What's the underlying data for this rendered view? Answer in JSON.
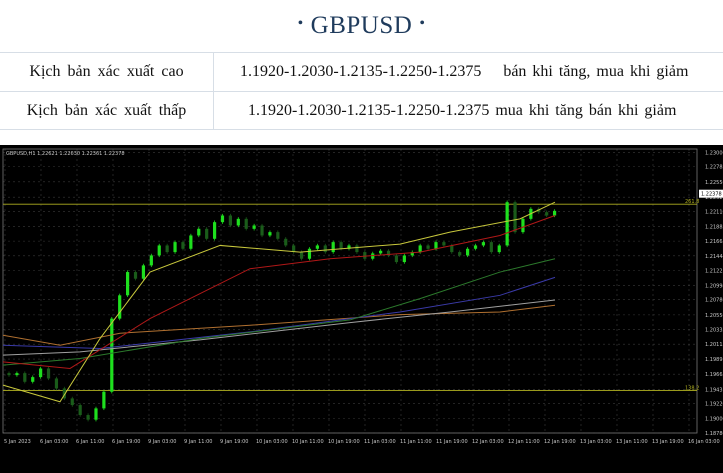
{
  "header": {
    "title": "GBPUSD",
    "dot": "•"
  },
  "scenarios": [
    {
      "label": "Kịch bản xác xuất cao",
      "levels": "1.1920-1.2030-1.2135-1.2250-1.2375",
      "action": "bán khi tăng, mua khi giảm"
    },
    {
      "label": "Kịch bản xác xuất thấp",
      "levels": "1.1920-1.2030-1.2135-1.2250-1.2375",
      "action": "mua khi tăng bán khi giảm"
    }
  ],
  "chart": {
    "info_line": "GBPUSD,H1  1.22621 1.22630 1.22361 1.22378",
    "price_tag": "1.22378",
    "hline_labels": {
      "upper": "261.8",
      "lower": "138.2"
    },
    "colors": {
      "background": "#000000",
      "bull": "#1ee01e",
      "bear": "#1a5c1a",
      "ma_yellow": "#c8c83c",
      "ma_red": "#b01818",
      "ma_green": "#2c7a2c",
      "ma_blue": "#3a3aa8",
      "ma_white": "#a0a0a0",
      "ma_orange": "#b07030",
      "hline": "#b0b020",
      "grid": "#3a3a3a",
      "axis_text": "#c8c8c8"
    }
  },
  "chart_data": {
    "type": "line",
    "title": "",
    "symbol": "GBPUSD",
    "timeframe": "H1",
    "ohlc": {
      "open": "1.22621",
      "high": "1.22630",
      "low": "1.22361",
      "close": "1.22378"
    },
    "y_ticks": [
      "1.23000",
      "1.22785",
      "1.22556",
      "1.22326",
      "1.22110",
      "1.21885",
      "1.21665",
      "1.21444",
      "1.21225",
      "1.20998",
      "1.20786",
      "1.20556",
      "1.20335",
      "1.20115",
      "1.19891",
      "1.19665",
      "1.19431",
      "1.19220",
      "1.19000",
      "1.18780"
    ],
    "x_ticks": [
      "5 Jan 2023",
      "6 Jan 03:00",
      "6 Jan 11:00",
      "6 Jan 19:00",
      "9 Jan 03:00",
      "9 Jan 11:00",
      "9 Jan 19:00",
      "10 Jan 03:00",
      "10 Jan 11:00",
      "10 Jan 19:00",
      "11 Jan 03:00",
      "11 Jan 11:00",
      "11 Jan 19:00",
      "12 Jan 03:00",
      "12 Jan 11:00",
      "12 Jan 19:00",
      "13 Jan 03:00",
      "13 Jan 11:00",
      "13 Jan 19:00",
      "16 Jan 03:00"
    ],
    "horizontal_levels": [
      {
        "label": "261.8",
        "value": 1.2222
      },
      {
        "label": "138.2",
        "value": 1.1942
      }
    ],
    "close_series": [
      1.1965,
      1.1968,
      1.1955,
      1.1962,
      1.1975,
      1.196,
      1.1945,
      1.193,
      1.192,
      1.1905,
      1.1898,
      1.1915,
      1.194,
      1.205,
      1.2085,
      1.212,
      1.211,
      1.213,
      1.2145,
      1.216,
      1.215,
      1.2165,
      1.2155,
      1.2175,
      1.2185,
      1.217,
      1.2195,
      1.2205,
      1.219,
      1.22,
      1.2185,
      1.219,
      1.2175,
      1.218,
      1.217,
      1.216,
      1.215,
      1.214,
      1.2155,
      1.216,
      1.215,
      1.2165,
      1.2155,
      1.216,
      1.215,
      1.214,
      1.2148,
      1.2152,
      1.2145,
      1.2135,
      1.2145,
      1.215,
      1.216,
      1.2155,
      1.2165,
      1.216,
      1.215,
      1.2145,
      1.2155,
      1.216,
      1.2165,
      1.215,
      1.216,
      1.2225,
      1.218,
      1.22,
      1.2215,
      1.221,
      1.2205,
      1.2212,
      1.2208,
      1.22,
      1.219,
      1.2175,
      1.2205,
      1.221,
      1.2195,
      1.218,
      1.22,
      1.2215,
      1.222,
      1.223,
      1.225,
      1.227,
      1.2262,
      1.225,
      1.2238
    ]
  }
}
